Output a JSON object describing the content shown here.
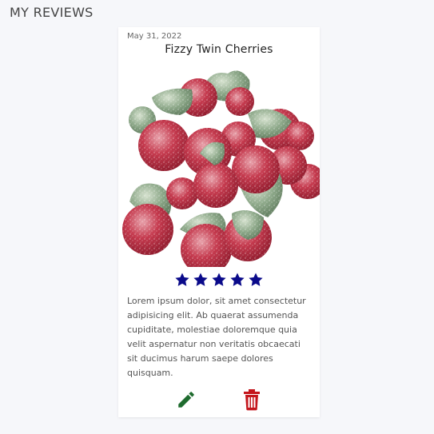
{
  "page": {
    "heading": "MY REVIEWS"
  },
  "review": {
    "date": "May 31, 2022",
    "title": "Fizzy Twin Cherries",
    "rating": 5,
    "rating_max": 5,
    "text": "Lorem ipsum dolor, sit amet consectetur adipisicing elit. Ab quaerat assumenda cupiditate, molestiae doloremque quia velit aspernatur non veritatis obcaecati sit ducimus harum saepe dolores quisquam.",
    "image_subject": "sugar-coated cherry gummy candies",
    "star_icon": "star-icon",
    "star_color": "#0a0a8a",
    "actions": {
      "edit_icon": "pencil-icon",
      "edit_color": "#1e6b2e",
      "delete_icon": "trash-icon",
      "delete_color": "#c4161c"
    }
  }
}
